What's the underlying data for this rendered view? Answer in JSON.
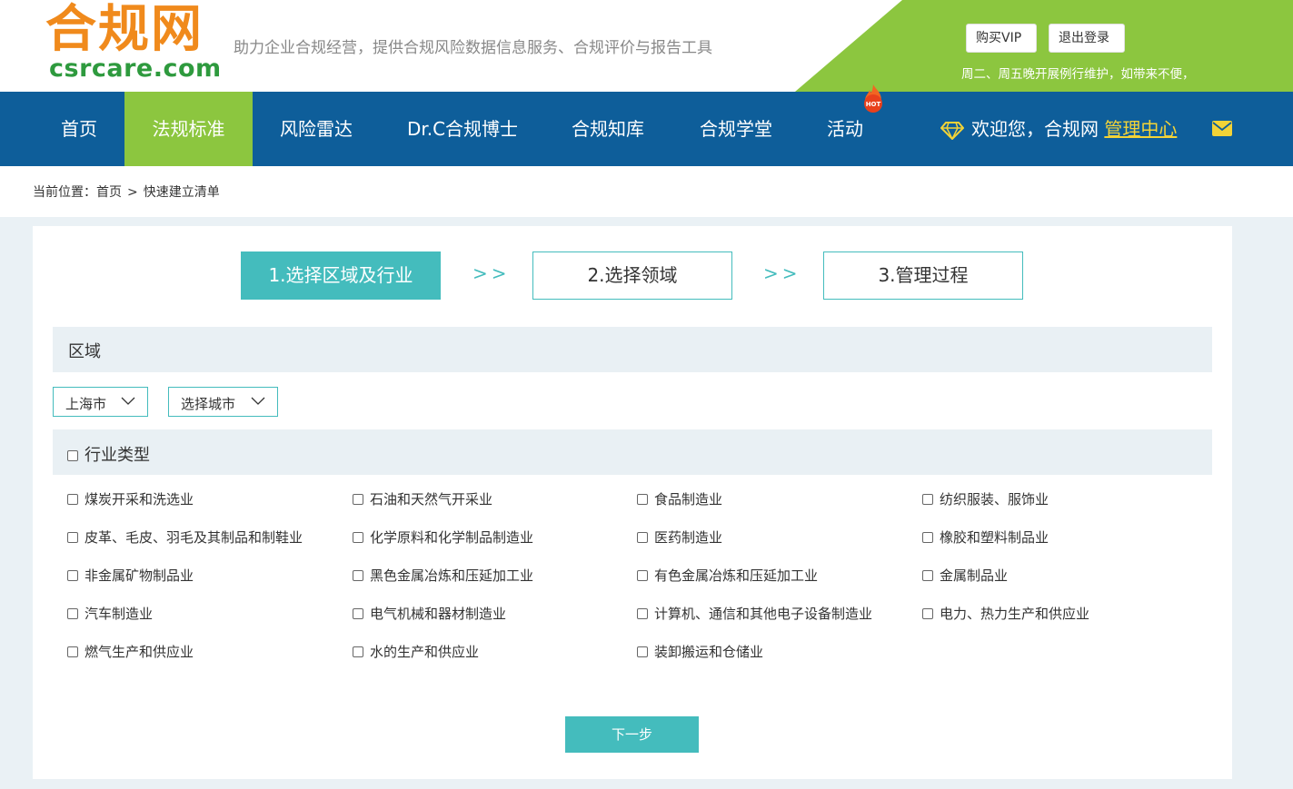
{
  "header": {
    "logo_cn": "合规网",
    "logo_en": "csrcare.com",
    "tagline": "助力企业合规经营，提供合规风险数据信息服务、合规评价与报告工具",
    "buy_vip": "购买VIP",
    "logout": "退出登录",
    "notice": "周二、周五晚开展例行维护，如带来不便，"
  },
  "nav": {
    "items": [
      {
        "label": "首页"
      },
      {
        "label": "法规标准",
        "active": true
      },
      {
        "label": "风险雷达"
      },
      {
        "label": "Dr.C合规博士"
      },
      {
        "label": "合规知库"
      },
      {
        "label": "合规学堂"
      },
      {
        "label": "活动"
      }
    ],
    "hot_badge": "HOT",
    "welcome": "欢迎您，合规网",
    "manage": "管理中心"
  },
  "breadcrumb": {
    "prefix": "当前位置：",
    "home": "首页",
    "separator": ">",
    "current": "快速建立清单"
  },
  "steps": {
    "step1": "1.选择区域及行业",
    "step2": "2.选择领域",
    "step3": "3.管理过程",
    "arrow": ">>"
  },
  "region": {
    "title": "区域",
    "province": "上海市",
    "city": "选择城市"
  },
  "industry": {
    "title": "行业类型",
    "items": [
      "煤炭开采和洗选业",
      "石油和天然气开采业",
      "食品制造业",
      "纺织服装、服饰业",
      "皮革、毛皮、羽毛及其制品和制鞋业",
      "化学原料和化学制品制造业",
      "医药制造业",
      "橡胶和塑料制品业",
      "非金属矿物制品业",
      "黑色金属冶炼和压延加工业",
      "有色金属冶炼和压延加工业",
      "金属制品业",
      "汽车制造业",
      "电气机械和器材制造业",
      "计算机、通信和其他电子设备制造业",
      "电力、热力生产和供应业",
      "燃气生产和供应业",
      "水的生产和供应业",
      "装卸搬运和仓储业"
    ]
  },
  "next_button": "下一步",
  "colors": {
    "nav_blue": "#0e5e9a",
    "green": "#8cc63f",
    "teal": "#44bcbd",
    "orange": "#f08a1c",
    "logo_green": "#2e9a3e"
  }
}
